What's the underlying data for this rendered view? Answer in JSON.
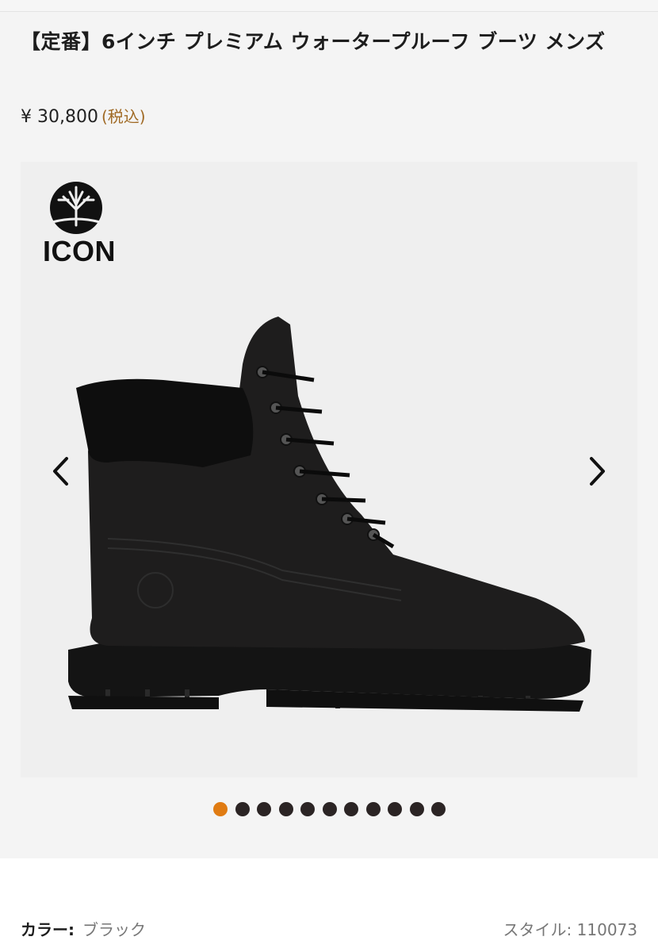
{
  "product": {
    "title": "【定番】6インチ プレミアム ウォータープルーフ ブーツ メンズ",
    "price": "¥ 30,800",
    "tax_note": "(税込)"
  },
  "gallery": {
    "badge_text": "ICON",
    "logo_icon": "tree-logo-icon",
    "prev_icon": "chevron-left-icon",
    "next_icon": "chevron-right-icon",
    "slide_count": 11,
    "active_slide": 1,
    "colors": {
      "active_dot": "#e07b12",
      "inactive_dot": "#2b2424"
    }
  },
  "details": {
    "color_label": "カラー:",
    "color_value": "ブラック",
    "style_label": "スタイル:",
    "style_value": "110073"
  }
}
